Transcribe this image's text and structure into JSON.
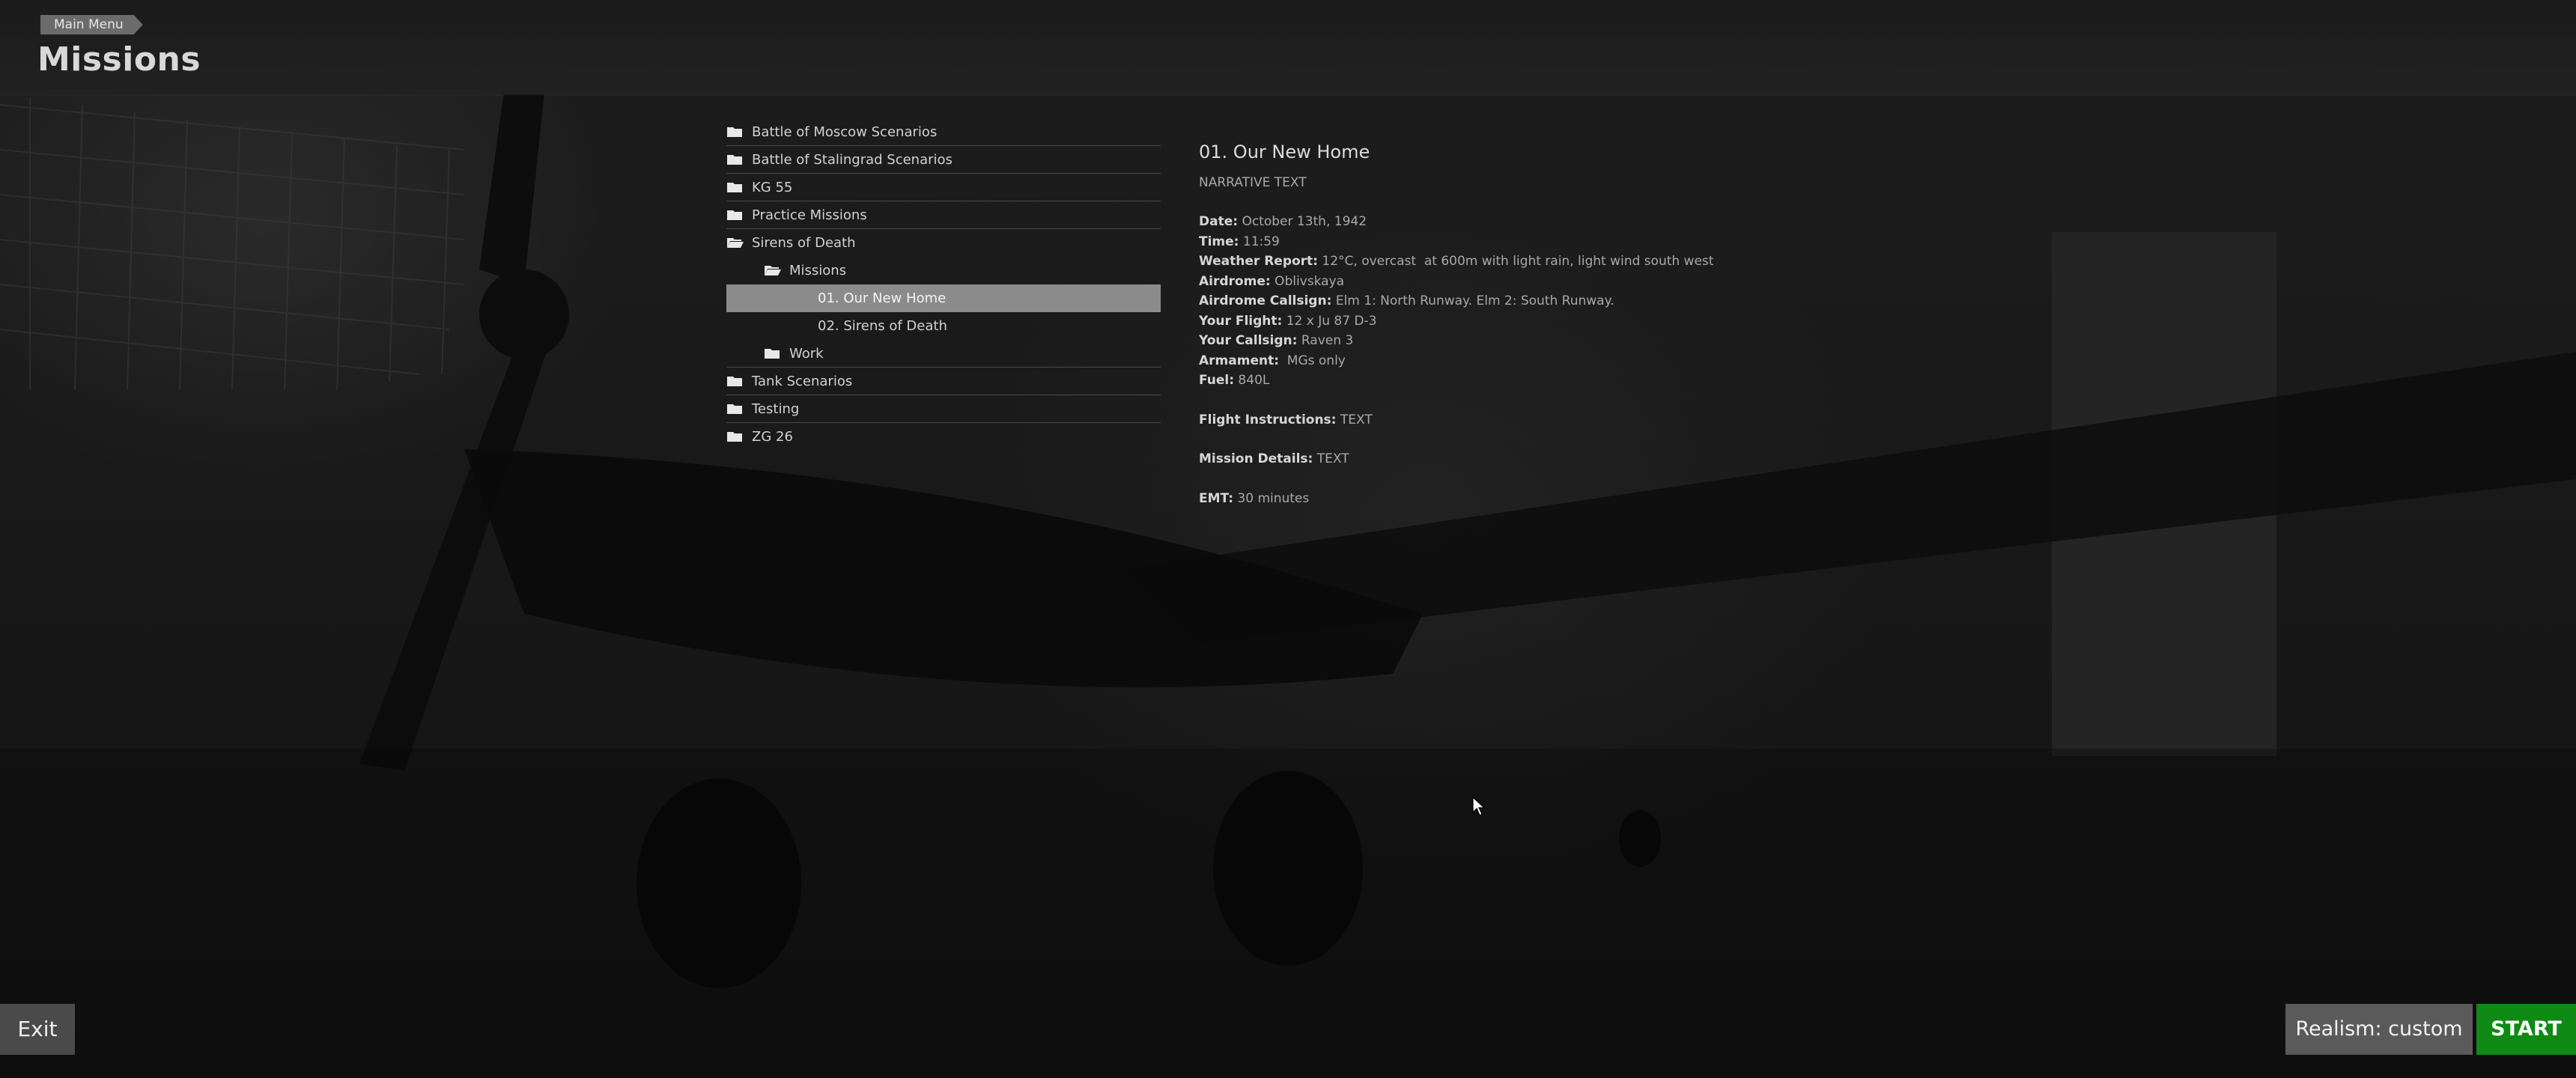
{
  "header": {
    "breadcrumb": "Main Menu",
    "title": "Missions"
  },
  "tree": {
    "items": [
      {
        "label": "Battle of Moscow Scenarios",
        "icon": "folder-closed-icon",
        "level": 0
      },
      {
        "label": "Battle of Stalingrad Scenarios",
        "icon": "folder-closed-icon",
        "level": 0
      },
      {
        "label": "KG 55",
        "icon": "folder-closed-icon",
        "level": 0
      },
      {
        "label": "Practice Missions",
        "icon": "folder-closed-icon",
        "level": 0
      },
      {
        "label": "Sirens of Death",
        "icon": "folder-open-icon",
        "level": 0
      },
      {
        "label": "Missions",
        "icon": "folder-open-icon",
        "level": 1
      },
      {
        "label": "01. Our New Home",
        "icon": "",
        "level": 2,
        "selected": true
      },
      {
        "label": "02. Sirens of Death",
        "icon": "",
        "level": 2
      },
      {
        "label": "Work",
        "icon": "folder-closed-icon",
        "level": 1
      },
      {
        "label": "Tank Scenarios",
        "icon": "folder-closed-icon",
        "level": 0
      },
      {
        "label": "Testing",
        "icon": "folder-closed-icon",
        "level": 0
      },
      {
        "label": "ZG 26",
        "icon": "folder-closed-icon",
        "level": 0
      }
    ]
  },
  "mission": {
    "title": "01. Our New Home",
    "narrative": "NARRATIVE TEXT",
    "date_label": "Date:",
    "date_value": " October 13th, 1942",
    "time_label": "Time:",
    "time_value": " 11:59",
    "weather_label": "Weather Report:",
    "weather_value": " 12°C, overcast  at 600m with light rain, light wind south west",
    "airdrome_label": "Airdrome:",
    "airdrome_value": " Oblivskaya",
    "callsign_label": "Airdrome Callsign:",
    "callsign_value": " Elm 1: North Runway. Elm 2: South Runway.",
    "flight_label": "Your Flight:",
    "flight_value": " 12 x Ju 87 D-3",
    "your_callsign_label": "Your Callsign:",
    "your_callsign_value": " Raven 3",
    "armament_label": "Armament:",
    "armament_value": "  MGs only",
    "fuel_label": "Fuel:",
    "fuel_value": " 840L",
    "instructions_label": "Flight Instructions:",
    "instructions_value": " TEXT",
    "details_label": "Mission Details:",
    "details_value": " TEXT",
    "emt_label": "EMT:",
    "emt_value": " 30 minutes"
  },
  "buttons": {
    "exit": "Exit",
    "realism": "Realism: custom",
    "start": "START"
  },
  "colors": {
    "start_green": "#0f8a14",
    "selected_row": "#8b8b8b",
    "background": "#141414"
  }
}
